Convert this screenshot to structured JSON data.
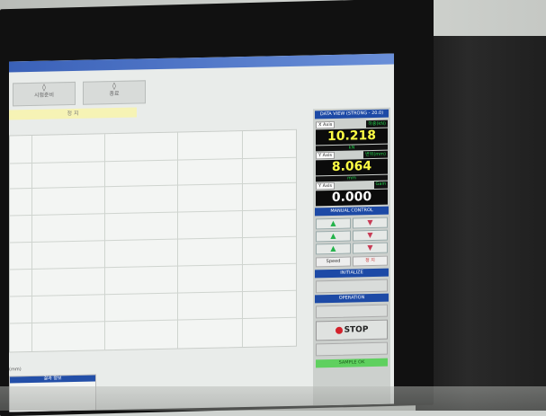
{
  "toolbar": {
    "btn1": "시험준비",
    "btn2": "종료"
  },
  "status_strip": "정 지",
  "panel": {
    "title": "DATA VIEW (STRONG - 20.0)",
    "ch1_label": "X Axis",
    "ch1_mode": "하중(kN)",
    "ch1_value": "10.218",
    "ch1_unit": "kN",
    "ch2_label": "Y Axis",
    "ch2_mode": "변위(mm)",
    "ch2_value": "8.064",
    "ch2_unit": "mm",
    "ch3_label": "Y Axis",
    "ch3_mode": "Gain",
    "ch3_value": "0.000",
    "manual_title": "MANUAL CONTROL",
    "mini_a": "Speed",
    "mini_b": "정 지",
    "section2": "INITIALIZE",
    "section3": "OPERATION",
    "stop_label": "STOP",
    "green_label": "SAMPLE OK"
  },
  "bottom": {
    "small_label": "(mm)",
    "hdr": "결과 정보"
  }
}
